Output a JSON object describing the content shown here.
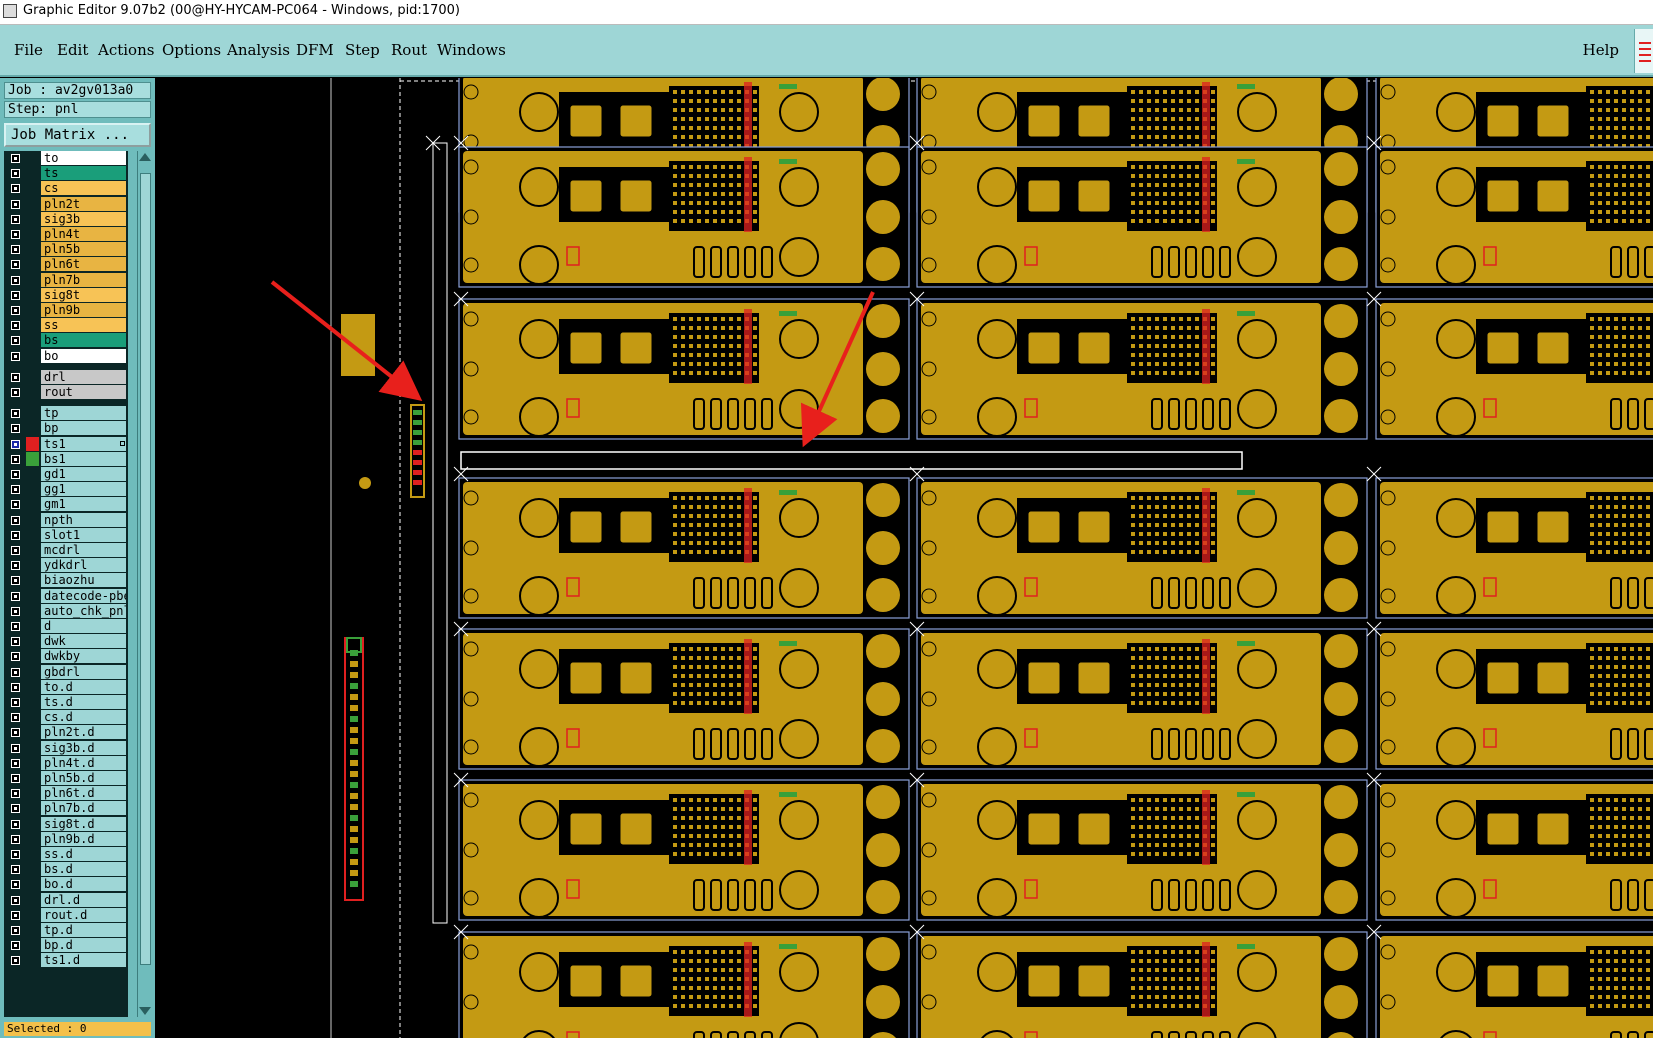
{
  "window": {
    "title": "Graphic Editor 9.07b2 (00@HY-HYCAM-PC064 - Windows, pid:1700)"
  },
  "menu": {
    "items": [
      "File",
      "Edit",
      "Actions",
      "Options",
      "Analysis",
      "DFM",
      "Step",
      "Rout",
      "Windows"
    ],
    "help": "Help"
  },
  "job": {
    "job_label": "Job : av2gv013a0",
    "step_label": "Step: pnl",
    "matrix_button": "Job Matrix ..."
  },
  "layers": [
    {
      "name": "to",
      "color": "#ffffff"
    },
    {
      "name": "ts",
      "color": "#1a9e7a"
    },
    {
      "name": "cs",
      "color": "#f7c356"
    },
    {
      "name": "pln2t",
      "color": "#e8b442"
    },
    {
      "name": "sig3b",
      "color": "#f7c356"
    },
    {
      "name": "pln4t",
      "color": "#e8b442"
    },
    {
      "name": "pln5b",
      "color": "#e8b442"
    },
    {
      "name": "pln6t",
      "color": "#e8b442"
    },
    {
      "name": "pln7b",
      "color": "#e8b442"
    },
    {
      "name": "sig8t",
      "color": "#f7c356"
    },
    {
      "name": "pln9b",
      "color": "#e8b442"
    },
    {
      "name": "ss",
      "color": "#f7c356"
    },
    {
      "name": "bs",
      "color": "#1a9e7a"
    },
    {
      "name": "bo",
      "color": "#ffffff"
    },
    {
      "name": "drl",
      "color": "#c8c8c8"
    },
    {
      "name": "rout",
      "color": "#c8c8c8"
    },
    {
      "name": "tp",
      "color": "#9ed6d6"
    },
    {
      "name": "bp",
      "color": "#9ed6d6"
    },
    {
      "name": "ts1",
      "color": "#9ed6d6",
      "swatch": "#e02020",
      "active": true
    },
    {
      "name": "bs1",
      "color": "#9ed6d6",
      "swatch": "#3aa03a"
    },
    {
      "name": "gd1",
      "color": "#9ed6d6"
    },
    {
      "name": "gg1",
      "color": "#9ed6d6"
    },
    {
      "name": "gm1",
      "color": "#9ed6d6"
    },
    {
      "name": "npth",
      "color": "#9ed6d6"
    },
    {
      "name": "slot1",
      "color": "#9ed6d6"
    },
    {
      "name": "mcdrl",
      "color": "#9ed6d6"
    },
    {
      "name": "ydkdrl",
      "color": "#9ed6d6"
    },
    {
      "name": "biaozhu",
      "color": "#9ed6d6"
    },
    {
      "name": "datecode-pbe",
      "color": "#9ed6d6"
    },
    {
      "name": "auto_chk_pnl",
      "color": "#9ed6d6"
    },
    {
      "name": "d",
      "color": "#9ed6d6"
    },
    {
      "name": "dwk",
      "color": "#9ed6d6"
    },
    {
      "name": "dwkby",
      "color": "#9ed6d6"
    },
    {
      "name": "gbdrl",
      "color": "#9ed6d6"
    },
    {
      "name": "to.d",
      "color": "#9ed6d6"
    },
    {
      "name": "ts.d",
      "color": "#9ed6d6"
    },
    {
      "name": "cs.d",
      "color": "#9ed6d6"
    },
    {
      "name": "pln2t.d",
      "color": "#9ed6d6"
    },
    {
      "name": "sig3b.d",
      "color": "#9ed6d6"
    },
    {
      "name": "pln4t.d",
      "color": "#9ed6d6"
    },
    {
      "name": "pln5b.d",
      "color": "#9ed6d6"
    },
    {
      "name": "pln6t.d",
      "color": "#9ed6d6"
    },
    {
      "name": "pln7b.d",
      "color": "#9ed6d6"
    },
    {
      "name": "sig8t.d",
      "color": "#9ed6d6"
    },
    {
      "name": "pln9b.d",
      "color": "#9ed6d6"
    },
    {
      "name": "ss.d",
      "color": "#9ed6d6"
    },
    {
      "name": "bs.d",
      "color": "#9ed6d6"
    },
    {
      "name": "bo.d",
      "color": "#9ed6d6"
    },
    {
      "name": "drl.d",
      "color": "#9ed6d6"
    },
    {
      "name": "rout.d",
      "color": "#9ed6d6"
    },
    {
      "name": "tp.d",
      "color": "#9ed6d6"
    },
    {
      "name": "bp.d",
      "color": "#9ed6d6"
    },
    {
      "name": "ts1.d",
      "color": "#9ed6d6"
    }
  ],
  "status": {
    "selected": "Selected : 0"
  },
  "colors": {
    "copper": "#c49a13",
    "board_outline": "#8aa0d8",
    "panel_frame": "#ffffff",
    "annotation_arrow": "#e8201c",
    "menubar": "#9ed6d6",
    "panel_bg": "#6fbcbc"
  }
}
